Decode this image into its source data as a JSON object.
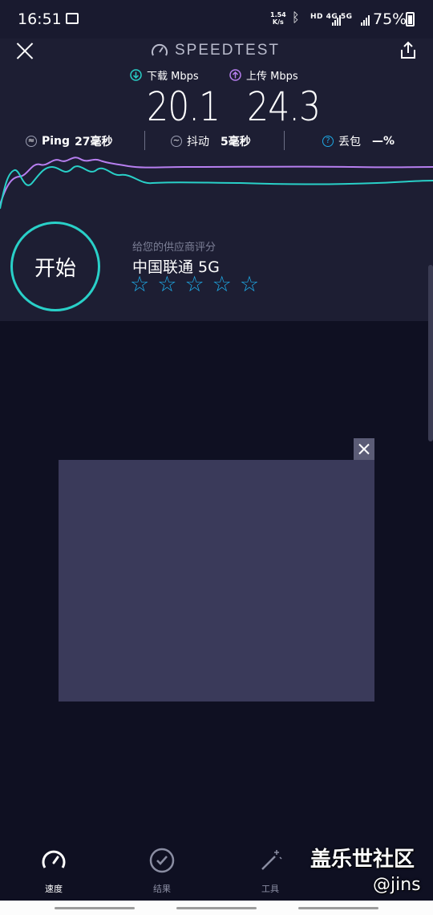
{
  "status_bar": {
    "time": "16:51",
    "net_speed_value": "1.54",
    "net_speed_unit": "K/s",
    "network": "HD 4G 5G",
    "battery": "75%"
  },
  "header": {
    "title": "SPEEDTEST",
    "download_label": "下载 Mbps",
    "download_value": "20.1",
    "upload_label": "上传 Mbps",
    "upload_value": "24.3",
    "download_color": "#29d0c8",
    "upload_color": "#b77ff0"
  },
  "stats": {
    "ping_label": "Ping",
    "ping_value": "27毫秒",
    "jitter_label": "抖动",
    "jitter_value": "5毫秒",
    "loss_label": "丢包",
    "loss_value": "—%"
  },
  "start": {
    "label": "开始"
  },
  "provider": {
    "rate_prompt": "给您的供应商评分",
    "name": "中国联通 5G",
    "stars": [
      "☆",
      "☆",
      "☆",
      "☆",
      "☆"
    ]
  },
  "tabs": [
    {
      "label": "速度",
      "icon": "speedometer-icon",
      "active": true
    },
    {
      "label": "结果",
      "icon": "check-circle-icon",
      "active": false
    },
    {
      "label": "工具",
      "icon": "magic-wand-icon",
      "active": false
    }
  ],
  "watermark": {
    "line1": "盖乐世社区",
    "line2": "@jins"
  }
}
